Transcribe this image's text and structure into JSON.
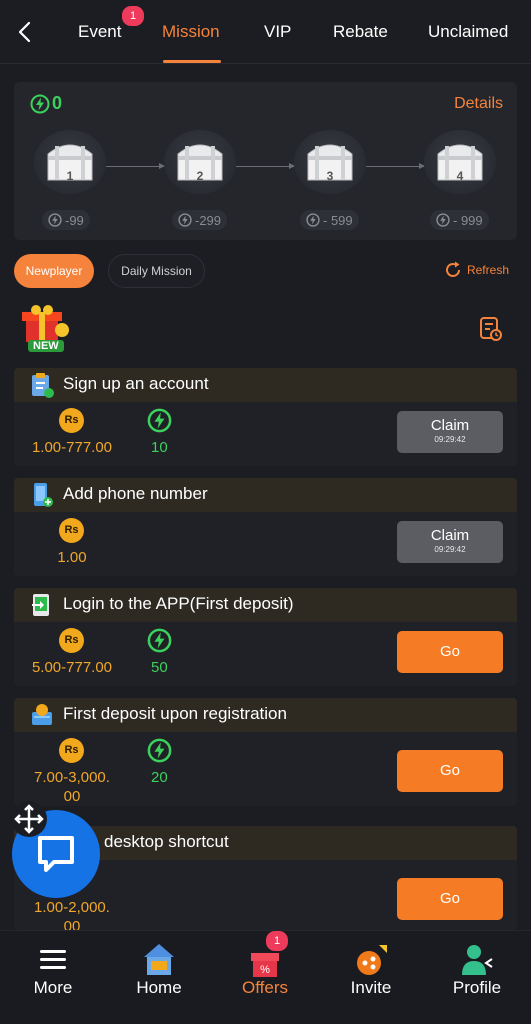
{
  "nav": {
    "tabs": [
      {
        "label": "Event",
        "badge": "1"
      },
      {
        "label": "Mission",
        "active": true
      },
      {
        "label": "VIP"
      },
      {
        "label": "Rebate"
      },
      {
        "label": "Unclaimed"
      }
    ]
  },
  "chests": {
    "bolt_count": "0",
    "details_label": "Details",
    "items": [
      {
        "number": "1",
        "cost": "-99"
      },
      {
        "number": "2",
        "cost": "-299"
      },
      {
        "number": "3",
        "cost": "- 599"
      },
      {
        "number": "4",
        "cost": "- 999"
      }
    ]
  },
  "filters": {
    "newplayer": "Newplayer",
    "daily": "Daily Mission",
    "refresh": "Refresh"
  },
  "new_label": "NEW",
  "missions": [
    {
      "title": "Sign up an account",
      "reward": "1.00-777.00",
      "bolts": "10",
      "button": "Claim",
      "timer": "09:29:42"
    },
    {
      "title": "Add phone number",
      "reward": "1.00",
      "bolts": "",
      "button": "Claim",
      "timer": "09:29:42"
    },
    {
      "title": "Login to the APP(First deposit)",
      "reward": "5.00-777.00",
      "bolts": "50",
      "button": "Go"
    },
    {
      "title": "First deposit upon registration",
      "reward_line1": "7.00-3,000.",
      "reward_line2": "00",
      "bolts": "20",
      "button": "Go"
    },
    {
      "title": "desktop shortcut",
      "reward_line1": "1.00-2,000.",
      "reward_line2": "00",
      "button": "Go"
    }
  ],
  "rs_label": "Rs",
  "bottom_nav": [
    {
      "label": "More"
    },
    {
      "label": "Home"
    },
    {
      "label": "Offers",
      "badge": "1",
      "active": true
    },
    {
      "label": "Invite"
    },
    {
      "label": "Profile"
    }
  ],
  "colors": {
    "accent": "#f5833b",
    "green": "#3bd15d",
    "gold": "#f0a72a",
    "chat": "#1673e6",
    "badge": "#ef3b5b"
  }
}
